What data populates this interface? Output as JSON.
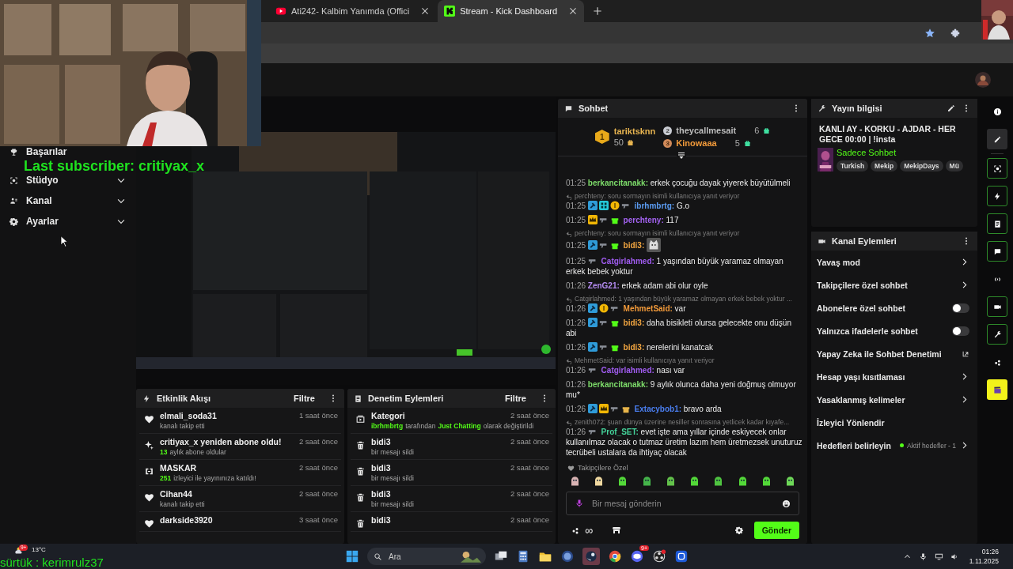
{
  "browser": {
    "tabs": [
      {
        "title": "Ati242- Kalbim Yanımda (Offici",
        "kind": "video",
        "selected": false
      },
      {
        "title": "Stream - Kick Dashboard",
        "kind": "kick",
        "selected": true
      }
    ]
  },
  "overlay": {
    "subscriber": "Last subscriber: critiyax_x",
    "chat_line": "sürtük : kerimrulz37"
  },
  "sidebar": {
    "items": [
      {
        "label": "Başarılar",
        "kind": "trophy",
        "expandable": false,
        "expanded": false
      },
      {
        "label": "Stüdyo",
        "kind": "focus",
        "expandable": true,
        "expanded": false
      },
      {
        "label": "Kanal",
        "kind": "users",
        "expandable": true,
        "expanded": false
      },
      {
        "label": "Ayarlar",
        "kind": "gear",
        "expandable": true,
        "expanded": false
      }
    ]
  },
  "activity": {
    "title": "Etkinlik Akışı",
    "filter": "Filtre",
    "items": [
      {
        "kind": "heart",
        "title": "elmali_soda31",
        "detail": "kanalı takip etti",
        "time": "1 saat önce"
      },
      {
        "kind": "sparkle",
        "title": "critiyax_x yeniden abone oldu!",
        "count": "13",
        "detail": "aylık abone oldular",
        "time": "2 saat önce"
      },
      {
        "kind": "raid",
        "title": "MASKAR",
        "count": "251",
        "detail": "izleyici ile yayınınıza katıldı!",
        "time": "2 saat önce"
      },
      {
        "kind": "heart",
        "title": "Cihan44",
        "detail": "kanalı takip etti",
        "time": "2 saat önce"
      },
      {
        "kind": "heart",
        "title": "darkside3920",
        "time": "3 saat önce"
      }
    ]
  },
  "moderation": {
    "title": "Denetim Eylemleri",
    "filter": "Filtre",
    "items": [
      {
        "kind": "category",
        "title": "Kategori",
        "parts": [
          {
            "text": "ibrhmbrtg",
            "highlight": true
          },
          {
            "text": "tarafından",
            "highlight": false
          },
          {
            "text": "Just Chatting",
            "highlight": true
          },
          {
            "text": "olarak değiştirildi",
            "highlight": false
          }
        ],
        "time": "2 saat önce"
      },
      {
        "kind": "trash",
        "title": "bidi3",
        "parts": [
          {
            "text": "bir mesajı sildi",
            "highlight": false
          }
        ],
        "time": "2 saat önce"
      },
      {
        "kind": "trash",
        "title": "bidi3",
        "parts": [
          {
            "text": "bir mesajı sildi",
            "highlight": false
          }
        ],
        "time": "2 saat önce"
      },
      {
        "kind": "trash",
        "title": "bidi3",
        "parts": [
          {
            "text": "bir mesajı sildi",
            "highlight": false
          }
        ],
        "time": "2 saat önce"
      },
      {
        "kind": "trash",
        "title": "bidi3",
        "time": "2 saat önce"
      }
    ]
  },
  "chat": {
    "title": "Sohbet",
    "leaders": [
      {
        "rank": "1",
        "name": "tariktsknn",
        "count": "50"
      },
      {
        "rank": "2",
        "name": "theycallmesait",
        "count": "6"
      },
      {
        "rank": "3",
        "name": "Kinowaaa",
        "count": "5"
      }
    ],
    "messages": [
      {
        "time": "01:25",
        "user": "berkancitanakk:",
        "color": "#7ddc6a",
        "text": "erkek çocuğu dayak yiyerek büyütülmeli"
      },
      {
        "time": "01:25",
        "reply": "perchteny: soru sormayın isimli kullanıcıya yanıt veriyor",
        "badges": [
          {
            "kind": "mod"
          },
          {
            "kind": "og"
          },
          {
            "kind": "gifter"
          },
          {
            "kind": "gun"
          }
        ],
        "user": "ibrhmbrtg:",
        "color": "#5b9cf2",
        "text": "G.o"
      },
      {
        "time": "01:25",
        "badges": [
          {
            "kind": "crown"
          },
          {
            "kind": "gun"
          },
          {
            "kind": "gift"
          }
        ],
        "user": "perchteny:",
        "color": "#a463f2",
        "text": "117"
      },
      {
        "time": "01:25",
        "reply": "perchteny: soru sormayın isimli kullanıcıya yanıt veriyor",
        "badges": [
          {
            "kind": "mod"
          },
          {
            "kind": "gun"
          },
          {
            "kind": "gift"
          }
        ],
        "user": "bidi3:",
        "color": "#f2a641",
        "emote": true
      },
      {
        "time": "01:25",
        "badges": [
          {
            "kind": "gun"
          }
        ],
        "user": "Catgirlahmed:",
        "color": "#a05cf0",
        "text": "1 yaşından büyük yaramaz olmayan erkek bebek yoktur"
      },
      {
        "time": "01:26",
        "user": "ZenG21:",
        "color": "#b48cf2",
        "text": "erkek adam abi olur oyle"
      },
      {
        "time": "01:26",
        "reply": "Catgirlahmed: 1 yaşından büyük yaramaz olmayan erkek bebek yoktur ...",
        "badges": [
          {
            "kind": "mod"
          },
          {
            "kind": "gifter"
          },
          {
            "kind": "gun"
          }
        ],
        "user": "MehmetSaid:",
        "color": "#f29a3a",
        "text": "var"
      },
      {
        "time": "01:26",
        "badges": [
          {
            "kind": "mod"
          },
          {
            "kind": "gun"
          },
          {
            "kind": "gift"
          }
        ],
        "user": "bidi3:",
        "color": "#f2a641",
        "text": "daha bisikleti olursa gelecekte onu düşün abi"
      },
      {
        "time": "01:26",
        "badges": [
          {
            "kind": "mod"
          },
          {
            "kind": "gun"
          },
          {
            "kind": "gift"
          }
        ],
        "user": "bidi3:",
        "color": "#f2a641",
        "text": "nerelerini kanatcak"
      },
      {
        "time": "01:26",
        "reply": "MehmetSaid: var isimli kullanıcıya yanıt veriyor",
        "badges": [
          {
            "kind": "gun"
          }
        ],
        "user": "Catgirlahmed:",
        "color": "#a05cf0",
        "text": "nası var"
      },
      {
        "time": "01:26",
        "user": "berkancitanakk:",
        "color": "#7ddc6a",
        "text": "9 aylık olunca daha yeni doğmuş olmuyor mu*"
      },
      {
        "time": "01:26",
        "badges": [
          {
            "kind": "mod"
          },
          {
            "kind": "crown"
          },
          {
            "kind": "gun"
          },
          {
            "kind": "giftgold"
          }
        ],
        "user": "Extacybob1:",
        "color": "#4a7ef0",
        "text": "bravo arda"
      },
      {
        "time": "01:26",
        "reply": "zenith072: şuan dünya üzerine nesiller sonrasına yetlicek kadar kıyafe...",
        "badges": [
          {
            "kind": "gun"
          }
        ],
        "user": "Prof_SET:",
        "color": "#44d39a",
        "text": "evet işte ama yıllar içinde eskiyecek onlar kullanılmaz olacak o tutmaz üretim lazım hem üretmezsek unuturuz tecrübeli ustalara da ihtiyaç olacak"
      }
    ],
    "emote_label": "Takipçilere Özel",
    "placeholder": "Bir mesaj gönderin",
    "points": "∞",
    "send": "Gönder"
  },
  "stream_info": {
    "title": "Yayın bilgisi",
    "stream_title": "KANLI AY - KORKU - AJDAR - HER GECE 00:00 | !insta",
    "category": "Sadece Sohbet",
    "tags": [
      "Turkish",
      "Mekip",
      "MekipDays",
      "Mü"
    ]
  },
  "channel_actions": {
    "title": "Kanal Eylemleri",
    "items": [
      {
        "label": "Yavaş mod",
        "kind": "chevron"
      },
      {
        "label": "Takipçilere özel sohbet",
        "kind": "chevron"
      },
      {
        "label": "Abonelere özel sohbet",
        "kind": "toggle",
        "on": false
      },
      {
        "label": "Yalnızca ifadelerle sohbet",
        "kind": "toggle",
        "on": false
      },
      {
        "label": "Yapay Zeka ile Sohbet Denetimi",
        "kind": "external"
      },
      {
        "label": "Hesap yaşı kısıtlaması",
        "kind": "chevron"
      },
      {
        "label": "Yasaklanmış kelimeler",
        "kind": "chevron"
      },
      {
        "label": "İzleyici Yönlendir",
        "kind": "plain"
      },
      {
        "label": "Hedefleri belirleyin",
        "kind": "goal",
        "status": "Aktif hedefler - 1"
      }
    ]
  },
  "rail": [
    {
      "kind": "info",
      "selected": false,
      "active": false
    },
    {
      "kind": "pencil",
      "selected": true,
      "active": false
    },
    {
      "kind": "focus",
      "selected": false,
      "active": true
    },
    {
      "kind": "bolt",
      "selected": false,
      "active": true
    },
    {
      "kind": "note",
      "selected": false,
      "active": true
    },
    {
      "kind": "chat-bubble",
      "selected": false,
      "active": true
    },
    {
      "kind": "broadcast",
      "selected": false,
      "active": false
    },
    {
      "kind": "video-card",
      "selected": false,
      "active": true
    },
    {
      "kind": "wrench",
      "selected": false,
      "active": true
    },
    {
      "kind": "dots-cluster",
      "selected": false,
      "active": false
    },
    {
      "kind": "clapper",
      "selected": false,
      "active": false
    }
  ],
  "taskbar": {
    "weather_badge": "9+",
    "temperature": "13°C",
    "search": "Ara",
    "chat_badge": "9+",
    "time": "01:26",
    "date": "1.11.2025"
  }
}
